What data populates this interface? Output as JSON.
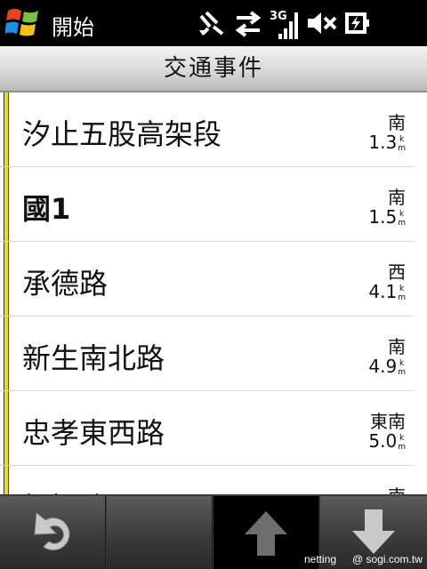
{
  "statusbar": {
    "start_label": "開始",
    "network_label": "3G",
    "icons": [
      "windows-logo-icon",
      "connectivity-icon",
      "data-transfer-icon",
      "signal-3g-icon",
      "volume-mute-icon",
      "battery-charging-icon"
    ]
  },
  "header": {
    "title": "交通事件"
  },
  "events": [
    {
      "name": "汐止五股高架段",
      "direction": "南",
      "distance": "1.3",
      "unit_top": "k",
      "unit_bottom": "m"
    },
    {
      "name": "國1",
      "direction": "南",
      "distance": "1.5",
      "unit_top": "k",
      "unit_bottom": "m"
    },
    {
      "name": "承德路",
      "direction": "西",
      "distance": "4.1",
      "unit_top": "k",
      "unit_bottom": "m"
    },
    {
      "name": "新生南北路",
      "direction": "南",
      "distance": "4.9",
      "unit_top": "k",
      "unit_bottom": "m"
    },
    {
      "name": "忠孝東西路",
      "direction": "東南",
      "distance": "5.0",
      "unit_top": "k",
      "unit_bottom": "m"
    },
    {
      "name": "松智路",
      "direction": "南",
      "distance": "",
      "unit_top": "",
      "unit_bottom": ""
    }
  ],
  "toolbar": {
    "icons": [
      "back-icon",
      "blank",
      "arrow-up-icon",
      "arrow-down-icon"
    ]
  },
  "watermark": {
    "left": "netting",
    "right": "@ sogi.com.tw"
  },
  "colors": {
    "accent_bar": "#f2e000",
    "status_bg": "#000000",
    "toolbar_bg": "#3a3a3a"
  }
}
